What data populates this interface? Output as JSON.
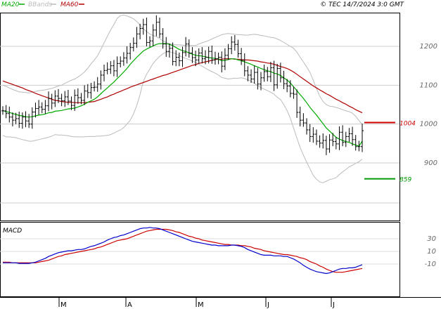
{
  "chart_data": [
    {
      "type": "candlestick",
      "legend": [
        {
          "name": "MA20",
          "color": "#00aa00"
        },
        {
          "name": "BBands",
          "color": "#bbbbbb"
        },
        {
          "name": "MA60",
          "color": "#b00000"
        }
      ],
      "watermark": "© TEC 14/7/2024 3:0 GMT",
      "y_ticks": [
        "1200",
        "1100",
        "1000",
        "900"
      ],
      "ylim": [
        800,
        1300
      ],
      "x_ticks": [
        "M",
        "A",
        "M",
        "J",
        "J"
      ],
      "levels": [
        {
          "label": "1004",
          "value": 1004,
          "color": "#cc0000"
        },
        {
          "label": "859",
          "value": 859,
          "color": "#009900"
        }
      ],
      "close": [
        1034,
        1027,
        1018,
        1010,
        1014,
        1002,
        1018,
        1008,
        1000,
        1031,
        1040,
        1044,
        1038,
        1047,
        1066,
        1054,
        1072,
        1066,
        1060,
        1070,
        1059,
        1048,
        1074,
        1068,
        1061,
        1085,
        1081,
        1094,
        1095,
        1103,
        1126,
        1138,
        1141,
        1150,
        1137,
        1156,
        1162,
        1170,
        1182,
        1197,
        1208,
        1232,
        1246,
        1256,
        1210,
        1214,
        1242,
        1262,
        1232,
        1206,
        1187,
        1195,
        1161,
        1172,
        1163,
        1184,
        1206,
        1183,
        1171,
        1165,
        1183,
        1168,
        1172,
        1187,
        1165,
        1168,
        1172,
        1149,
        1177,
        1194,
        1211,
        1205,
        1181,
        1164,
        1137,
        1126,
        1116,
        1133,
        1103,
        1119,
        1135,
        1122,
        1145,
        1101,
        1143,
        1119,
        1104,
        1098,
        1079,
        1077,
        1030,
        1010,
        1003,
        985,
        968,
        974,
        956,
        951,
        958,
        936,
        959,
        955,
        949,
        979,
        953,
        968,
        975,
        960,
        942,
        942,
        983
      ],
      "ma20": [
        1035,
        1032,
        1030,
        1027,
        1025,
        1022,
        1021,
        1019,
        1018,
        1019,
        1021,
        1023,
        1024,
        1026,
        1029,
        1030,
        1033,
        1034,
        1035,
        1037,
        1039,
        1040,
        1041,
        1044,
        1047,
        1051,
        1056,
        1060,
        1064,
        1070,
        1078,
        1086,
        1093,
        1101,
        1108,
        1117,
        1125,
        1134,
        1143,
        1154,
        1163,
        1172,
        1180,
        1188,
        1193,
        1197,
        1201,
        1205,
        1207,
        1207,
        1207,
        1205,
        1202,
        1197,
        1192,
        1189,
        1187,
        1183,
        1180,
        1177,
        1176,
        1175,
        1173,
        1171,
        1170,
        1169,
        1167,
        1163,
        1164,
        1166,
        1168,
        1168,
        1165,
        1163,
        1160,
        1157,
        1154,
        1150,
        1147,
        1143,
        1140,
        1137,
        1135,
        1131,
        1129,
        1125,
        1119,
        1113,
        1106,
        1096,
        1086,
        1076,
        1066,
        1055,
        1043,
        1033,
        1023,
        1012,
        1001,
        990,
        982,
        974,
        966,
        961,
        958,
        955,
        953,
        949,
        946,
        943,
        956
      ],
      "ma60": [
        1111,
        1108,
        1105,
        1102,
        1099,
        1096,
        1093,
        1089,
        1086,
        1083,
        1079,
        1076,
        1073,
        1070,
        1067,
        1064,
        1061,
        1060,
        1058,
        1057,
        1056,
        1056,
        1055,
        1055,
        1055,
        1055,
        1056,
        1057,
        1058,
        1061,
        1064,
        1067,
        1070,
        1074,
        1077,
        1081,
        1084,
        1088,
        1091,
        1095,
        1098,
        1101,
        1104,
        1107,
        1110,
        1113,
        1116,
        1119,
        1122,
        1125,
        1127,
        1130,
        1133,
        1136,
        1139,
        1142,
        1145,
        1148,
        1151,
        1153,
        1156,
        1158,
        1160,
        1162,
        1164,
        1166,
        1167,
        1167,
        1168,
        1168,
        1168,
        1167,
        1167,
        1166,
        1165,
        1165,
        1164,
        1163,
        1162,
        1160,
        1159,
        1157,
        1156,
        1154,
        1151,
        1148,
        1146,
        1143,
        1139,
        1134,
        1128,
        1122,
        1116,
        1110,
        1104,
        1098,
        1093,
        1088,
        1083,
        1078,
        1074,
        1069,
        1064,
        1060,
        1055,
        1051,
        1046,
        1042,
        1037,
        1033,
        1029
      ],
      "bb_upper": [
        1100,
        1097,
        1093,
        1089,
        1086,
        1083,
        1082,
        1081,
        1080,
        1082,
        1084,
        1086,
        1087,
        1088,
        1090,
        1092,
        1095,
        1098,
        1100,
        1105,
        1109,
        1113,
        1116,
        1121,
        1127,
        1134,
        1144,
        1155,
        1165,
        1176,
        1192,
        1209,
        1226,
        1242,
        1256,
        1272,
        1279,
        1281,
        1278,
        1275,
        1271,
        1264,
        1255,
        1245,
        1238,
        1232,
        1228,
        1225,
        1220,
        1214,
        1210,
        1207,
        1205,
        1204,
        1204,
        1203,
        1202,
        1202,
        1202,
        1202,
        1206,
        1209,
        1212,
        1215,
        1219,
        1223,
        1226,
        1230,
        1232,
        1233,
        1232,
        1231,
        1230,
        1230,
        1229,
        1229,
        1230,
        1231,
        1230,
        1228,
        1227,
        1225,
        1223,
        1222,
        1219,
        1215,
        1210,
        1205,
        1200,
        1195,
        1185,
        1172,
        1160,
        1147,
        1133,
        1113,
        1091,
        1072,
        1058,
        1050,
        1046,
        1045,
        1043,
        1040,
        1037,
        1034,
        1032,
        1028,
        1020,
        1009,
        999
      ],
      "bb_lower": [
        971,
        967,
        967,
        966,
        965,
        962,
        960,
        958,
        956,
        956,
        958,
        960,
        962,
        964,
        966,
        969,
        973,
        972,
        972,
        971,
        970,
        968,
        967,
        967,
        967,
        967,
        968,
        968,
        968,
        969,
        969,
        970,
        971,
        973,
        977,
        981,
        985,
        991,
        1000,
        1010,
        1026,
        1048,
        1076,
        1110,
        1128,
        1142,
        1156,
        1166,
        1174,
        1181,
        1185,
        1186,
        1184,
        1181,
        1176,
        1172,
        1169,
        1166,
        1162,
        1159,
        1154,
        1149,
        1144,
        1139,
        1135,
        1131,
        1126,
        1120,
        1118,
        1116,
        1117,
        1118,
        1118,
        1119,
        1117,
        1114,
        1110,
        1105,
        1099,
        1094,
        1090,
        1086,
        1082,
        1077,
        1069,
        1063,
        1050,
        1035,
        1015,
        990,
        964,
        940,
        920,
        902,
        885,
        868,
        858,
        851,
        849,
        853,
        857,
        859,
        862,
        870,
        877,
        883,
        890,
        894,
        899,
        903,
        910
      ],
      "macd": {
        "label": "MACD",
        "y_ticks": [
          "30",
          "10",
          "-10"
        ],
        "macd_line": [
          -8,
          -8,
          -8,
          -8,
          -8,
          -9,
          -9,
          -9,
          -9,
          -8,
          -7,
          -5,
          -3,
          -1,
          2,
          4,
          6,
          8,
          9,
          10,
          11,
          11,
          12,
          13,
          13,
          14,
          16,
          18,
          19,
          21,
          23,
          25,
          28,
          30,
          32,
          33,
          35,
          36,
          38,
          40,
          42,
          44,
          46,
          47,
          47,
          48,
          47,
          47,
          46,
          44,
          42,
          40,
          38,
          36,
          34,
          32,
          30,
          28,
          26,
          25,
          24,
          23,
          22,
          21,
          20,
          20,
          19,
          19,
          19,
          19,
          20,
          20,
          19,
          18,
          16,
          13,
          11,
          9,
          7,
          5,
          4,
          4,
          4,
          3,
          3,
          3,
          2,
          2,
          0,
          -2,
          -5,
          -8,
          -12,
          -15,
          -18,
          -20,
          -22,
          -23,
          -24,
          -25,
          -24,
          -22,
          -20,
          -18,
          -17,
          -17,
          -16,
          -16,
          -15,
          -13,
          -11
        ],
        "signal_line": [
          -7,
          -7,
          -7,
          -8,
          -8,
          -8,
          -8,
          -8,
          -8,
          -8,
          -8,
          -7,
          -6,
          -5,
          -4,
          -2,
          0,
          2,
          3,
          5,
          6,
          7,
          8,
          9,
          10,
          11,
          12,
          13,
          14,
          16,
          17,
          19,
          21,
          23,
          25,
          27,
          28,
          29,
          30,
          32,
          34,
          36,
          38,
          40,
          42,
          43,
          44,
          45,
          45,
          45,
          45,
          44,
          43,
          41,
          40,
          38,
          36,
          34,
          33,
          31,
          30,
          28,
          27,
          26,
          25,
          24,
          23,
          22,
          21,
          21,
          20,
          20,
          20,
          19,
          19,
          18,
          17,
          15,
          14,
          13,
          11,
          10,
          9,
          8,
          7,
          6,
          5,
          5,
          4,
          3,
          2,
          0,
          -1,
          -3,
          -6,
          -8,
          -10,
          -13,
          -15,
          -18,
          -20,
          -22,
          -23,
          -23,
          -23,
          -22,
          -21,
          -20,
          -19,
          -18,
          -17
        ]
      }
    }
  ]
}
